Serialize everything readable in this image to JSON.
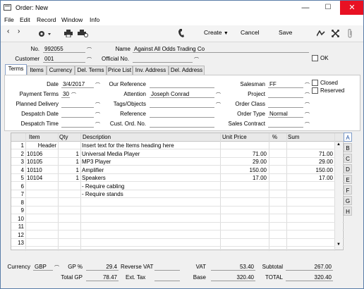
{
  "window": {
    "title": "Order: New",
    "minimize": "—",
    "maximize": "☐",
    "close": "✕"
  },
  "menu": [
    "File",
    "Edit",
    "Record",
    "Window",
    "Info"
  ],
  "toolbar": {
    "create_label": "Create",
    "cancel_label": "Cancel",
    "save_label": "Save"
  },
  "header": {
    "no_label": "No.",
    "no_value": "992055",
    "name_label": "Name",
    "name_value": "Against All Odds Trading Co",
    "customer_label": "Customer",
    "customer_value": "001",
    "official_label": "Official No.",
    "official_value": "",
    "ok_label": "OK"
  },
  "tabs": [
    "Terms",
    "Items",
    "Currency",
    "Del. Terms",
    "Price List",
    "Inv. Address",
    "Del. Address"
  ],
  "terms": {
    "date_label": "Date",
    "date_value": "3/4/2017",
    "payterms_label": "Payment Terms",
    "payterms_value": "30",
    "planned_label": "Planned Delivery",
    "planned_value": "",
    "despdate_label": "Despatch Date",
    "despdate_value": "",
    "desptime_label": "Despatch Time",
    "desptime_value": "",
    "ourref_label": "Our Reference",
    "ourref_value": "",
    "attention_label": "Attention",
    "attention_value": "Joseph Conrad",
    "tags_label": "Tags/Objects",
    "tags_value": "",
    "reference_label": "Reference",
    "reference_value": "",
    "custord_label": "Cust. Ord. No.",
    "custord_value": "",
    "salesman_label": "Salesman",
    "salesman_value": "FF",
    "project_label": "Project",
    "project_value": "",
    "orderclass_label": "Order Class",
    "orderclass_value": "",
    "ordertype_label": "Order Type",
    "ordertype_value": "Normal",
    "salescontract_label": "Sales Contract",
    "salescontract_value": "",
    "closed_label": "Closed",
    "reserved_label": "Reserved"
  },
  "matrix": {
    "headers": {
      "item": "Item",
      "qty": "Qty",
      "desc": "Description",
      "unit": "Unit Price",
      "pct": "%",
      "sum": "Sum"
    },
    "rows": [
      {
        "n": "1",
        "item": "Header",
        "qty": "",
        "desc": "Insert text for the Items heading here",
        "unit": "",
        "pct": "",
        "sum": ""
      },
      {
        "n": "2",
        "item": "10106",
        "qty": "1",
        "desc": "Universal Media Player",
        "unit": "71.00",
        "pct": "",
        "sum": "71.00"
      },
      {
        "n": "3",
        "item": "10105",
        "qty": "1",
        "desc": "MP3 Player",
        "unit": "29.00",
        "pct": "",
        "sum": "29.00"
      },
      {
        "n": "4",
        "item": "10110",
        "qty": "1",
        "desc": "Amplifier",
        "unit": "150.00",
        "pct": "",
        "sum": "150.00"
      },
      {
        "n": "5",
        "item": "10104",
        "qty": "1",
        "desc": "Speakers",
        "unit": "17.00",
        "pct": "",
        "sum": "17.00"
      },
      {
        "n": "6",
        "item": "",
        "qty": "",
        "desc": "- Require cabling",
        "unit": "",
        "pct": "",
        "sum": ""
      },
      {
        "n": "7",
        "item": "",
        "qty": "",
        "desc": "- Require stands",
        "unit": "",
        "pct": "",
        "sum": ""
      },
      {
        "n": "8",
        "item": "",
        "qty": "",
        "desc": "",
        "unit": "",
        "pct": "",
        "sum": ""
      },
      {
        "n": "9",
        "item": "",
        "qty": "",
        "desc": "",
        "unit": "",
        "pct": "",
        "sum": ""
      },
      {
        "n": "10",
        "item": "",
        "qty": "",
        "desc": "",
        "unit": "",
        "pct": "",
        "sum": ""
      },
      {
        "n": "11",
        "item": "",
        "qty": "",
        "desc": "",
        "unit": "",
        "pct": "",
        "sum": ""
      },
      {
        "n": "12",
        "item": "",
        "qty": "",
        "desc": "",
        "unit": "",
        "pct": "",
        "sum": ""
      },
      {
        "n": "13",
        "item": "",
        "qty": "",
        "desc": "",
        "unit": "",
        "pct": "",
        "sum": ""
      }
    ],
    "side_tabs": [
      "A",
      "B",
      "C",
      "D",
      "E",
      "F",
      "G",
      "H"
    ]
  },
  "footer": {
    "currency_label": "Currency",
    "currency_value": "GBP",
    "gppct_label": "GP %",
    "gppct_value": "29.4",
    "totalgp_label": "Total GP",
    "totalgp_value": "78.47",
    "revvat_label": "Reverse VAT",
    "revvat_value": "",
    "exttax_label": "Ext. Tax",
    "exttax_value": "",
    "vat_label": "VAT",
    "vat_value": "53.40",
    "base_label": "Base",
    "base_value": "320.40",
    "subtotal_label": "Subtotal",
    "subtotal_value": "267.00",
    "total_label": "TOTAL",
    "total_value": "320.40"
  }
}
